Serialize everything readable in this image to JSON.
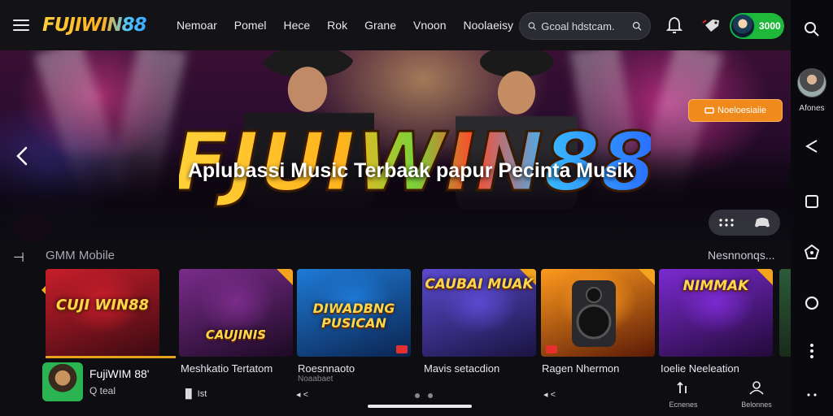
{
  "topbar": {
    "logo": "FUJIWIN88",
    "nav": [
      "Nemoar",
      "Pomel",
      "Hece",
      "Rok",
      "Grane",
      "Vnoon",
      "Noolaeisy"
    ],
    "search_placeholder": "Gcoal hdstcam.",
    "balance": "3000"
  },
  "hero": {
    "title": "FJUIWIN88",
    "tagline": "Aplubassi Music Terbaak papur Pecinta Musik",
    "cta": "Noeloesiaiie"
  },
  "section": {
    "title": "GMM Mobile",
    "more": "Nesnnonqs..."
  },
  "cards": [
    {
      "art": "CUJI WIN88",
      "label": "Fujiwim 88",
      "sub": "",
      "c1": "#c81e2a",
      "c2": "#3a0a12"
    },
    {
      "art": "CAUJINIS",
      "label": "Meshkatio Tertatom",
      "sub": "",
      "c1": "#7a2c8a",
      "c2": "#1c0a24"
    },
    {
      "art": "DIWADBNG PUSICAN",
      "label": "Roesnnaoto",
      "sub": "Noaabaet",
      "c1": "#1e7ad6",
      "c2": "#0b2450"
    },
    {
      "art": "CAUBAI MUAK",
      "label": "Mavis setacdion",
      "sub": "",
      "c1": "#5b4ad0",
      "c2": "#1a1440"
    },
    {
      "art": "",
      "label": "Ragen Nhermon",
      "sub": "",
      "c1": "#ff9a1e",
      "c2": "#5a1a06"
    },
    {
      "art": "NIMMAK",
      "label": "Ioelie Neeleation",
      "sub": "",
      "c1": "#7b2ad0",
      "c2": "#220a38"
    }
  ],
  "player": {
    "title": "FujiWIM 88'",
    "sub": "Q  teal",
    "ctrl1": "▐▌ Ist",
    "ctrl2": "◂ <",
    "ctrl3": "◂ <"
  },
  "bottom_tabs": [
    "Ecnenes",
    "Belonnes"
  ],
  "sidebar": {
    "label": "Afones"
  },
  "colors": {
    "accent": "#f08a1c",
    "balance": "#1fb83a",
    "background": "#0d0d12"
  }
}
